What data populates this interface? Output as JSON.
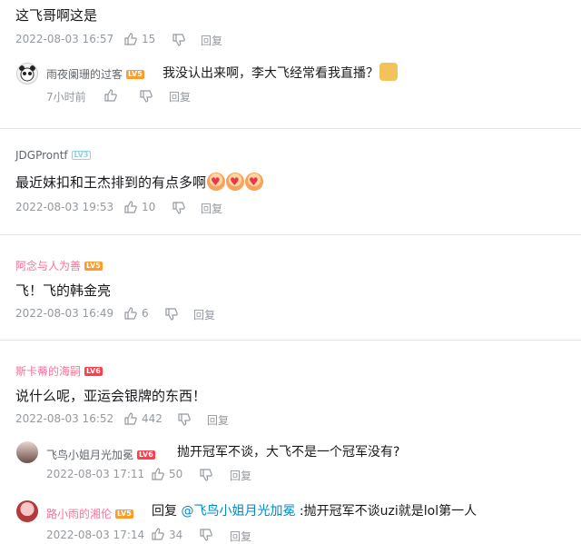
{
  "comments": [
    {
      "text": "这飞哥啊这是",
      "date": "2022-08-03 16:57",
      "likes": "15",
      "reply_label": "回复",
      "replies": [
        {
          "user": "雨夜阑珊的过客",
          "level": "LV5",
          "text": "我没认出来啊，李大飞经常看我直播？",
          "emoji": "doge",
          "date": "7小时前",
          "reply_label": "回复"
        }
      ]
    },
    {
      "user": "JDGProntf",
      "level": "LV3",
      "text": "最近妹扣和王杰排到的有点多啊",
      "emoji_count": 3,
      "date": "2022-08-03 19:53",
      "likes": "10",
      "reply_label": "回复"
    },
    {
      "user": "阿念与人为善",
      "level": "LV5",
      "text": "飞！飞的韩金亮",
      "date": "2022-08-03 16:49",
      "likes": "6",
      "reply_label": "回复"
    },
    {
      "user": "斯卡蒂的海嗣",
      "level": "LV6",
      "text": "说什么呢，亚运会银牌的东西！",
      "date": "2022-08-03 16:52",
      "likes": "442",
      "reply_label": "回复",
      "replies": [
        {
          "user": "飞鸟小姐月光加冕",
          "level": "LV6",
          "text": "抛开冠军不谈，大飞不是一个冠军没有?",
          "date": "2022-08-03 17:11",
          "likes": "50",
          "reply_label": "回复"
        },
        {
          "user": "路小雨的湘伦",
          "level": "LV5",
          "reply_prefix": "回复",
          "mention": "@飞鸟小姐月光加冕",
          "text": ":抛开冠军不谈uzi就是lol第一人",
          "date": "2022-08-03 17:14",
          "likes": "34",
          "reply_label": "回复"
        }
      ]
    }
  ]
}
